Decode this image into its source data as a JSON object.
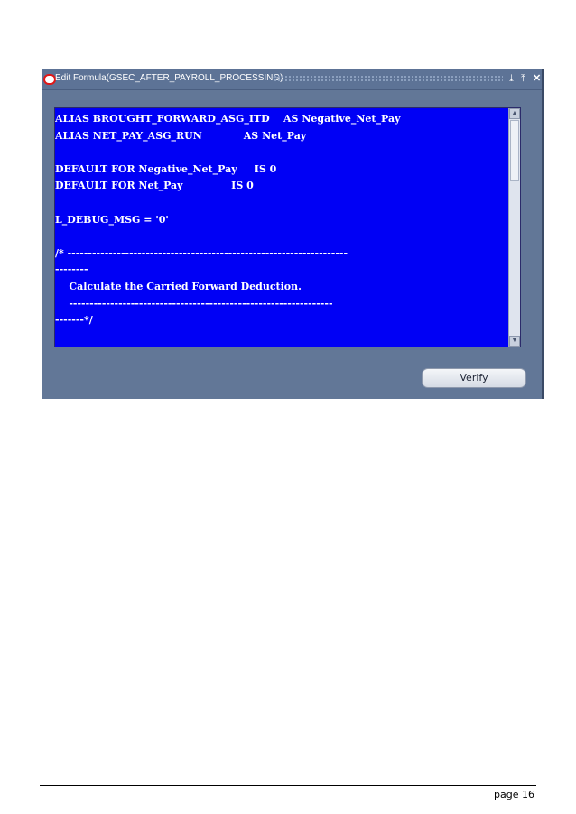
{
  "window": {
    "title": "Edit Formula(GSEC_AFTER_PAYROLL_PROCESSING)",
    "minimize_glyph": "⤓",
    "restore_glyph": "⤒",
    "close_glyph": "✕"
  },
  "editor": {
    "lines": [
      "ALIAS BROUGHT_FORWARD_ASG_ITD    AS Negative_Net_Pay",
      "ALIAS NET_PAY_ASG_RUN            AS Net_Pay",
      "",
      "DEFAULT FOR Negative_Net_Pay     IS 0",
      "DEFAULT FOR Net_Pay              IS 0",
      "",
      "L_DEBUG_MSG = '0'",
      "",
      "/* --------------------------------------------------------------------",
      "--------",
      "    Calculate the Carried Forward Deduction.",
      "    ----------------------------------------------------------------",
      "-------*/"
    ],
    "scroll_up_glyph": "▲",
    "scroll_down_glyph": "▼"
  },
  "actions": {
    "verify_label": "Verify"
  },
  "footer": {
    "page_label": "page 16"
  },
  "colors": {
    "editor_background": "#0000f5",
    "window_background": "#627797",
    "logo_red": "#e01818"
  }
}
